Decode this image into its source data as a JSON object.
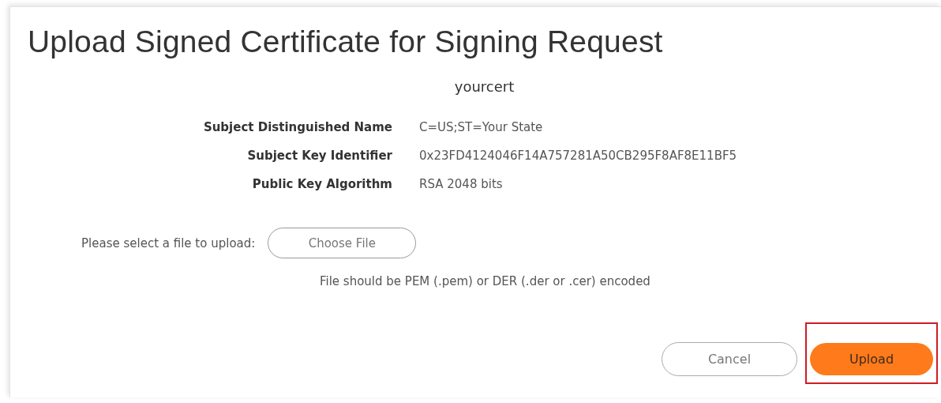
{
  "dialog": {
    "title": "Upload Signed Certificate for Signing Request",
    "certificate_name": "yourcert",
    "fields": [
      {
        "label": "Subject Distinguished Name",
        "value": "C=US;ST=Your State"
      },
      {
        "label": "Subject Key Identifier",
        "value": "0x23FD4124046F14A757281A50CB295F8AF8E11BF5"
      },
      {
        "label": "Public Key Algorithm",
        "value": "RSA 2048 bits"
      }
    ],
    "file_prompt": "Please select a file to upload:",
    "choose_file_button": "Choose File",
    "file_hint": "File should be PEM (.pem) or DER (.der or .cer) encoded",
    "buttons": [
      {
        "label": "Cancel",
        "kind": "secondary",
        "highlighted": false
      },
      {
        "label": "Upload",
        "kind": "primary",
        "highlighted": true
      }
    ]
  }
}
